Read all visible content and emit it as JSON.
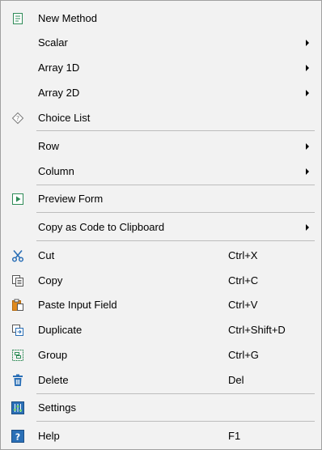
{
  "menu": {
    "new_method": {
      "label": "New Method",
      "icon": "form-icon"
    },
    "scalar": {
      "label": "Scalar"
    },
    "array_1d": {
      "label": "Array 1D"
    },
    "array_2d": {
      "label": "Array 2D"
    },
    "choice_list": {
      "label": "Choice List",
      "icon": "diamond-question-icon"
    },
    "row": {
      "label": "Row"
    },
    "column": {
      "label": "Column"
    },
    "preview_form": {
      "label": "Preview Form",
      "icon": "play-icon"
    },
    "copy_as_code": {
      "label": "Copy as Code to Clipboard"
    },
    "cut": {
      "label": "Cut",
      "shortcut": "Ctrl+X",
      "icon": "scissors-icon"
    },
    "copy": {
      "label": "Copy",
      "shortcut": "Ctrl+C",
      "icon": "copy-icon"
    },
    "paste_input_field": {
      "label": "Paste Input Field",
      "shortcut": "Ctrl+V",
      "icon": "paste-icon"
    },
    "duplicate": {
      "label": "Duplicate",
      "shortcut": "Ctrl+Shift+D",
      "icon": "duplicate-icon"
    },
    "group": {
      "label": "Group",
      "shortcut": "Ctrl+G",
      "icon": "group-icon"
    },
    "delete": {
      "label": "Delete",
      "shortcut": "Del",
      "icon": "trash-icon"
    },
    "settings": {
      "label": "Settings",
      "icon": "settings-icon"
    },
    "help": {
      "label": "Help",
      "shortcut": "F1",
      "icon": "help-icon"
    }
  },
  "colors": {
    "background": "#f2f2f2",
    "border": "#a0a0a0",
    "separator": "#bdbdbd",
    "icon_green": "#2e8b57",
    "icon_blue": "#2a6fb6",
    "icon_orange": "#e08a1e"
  }
}
